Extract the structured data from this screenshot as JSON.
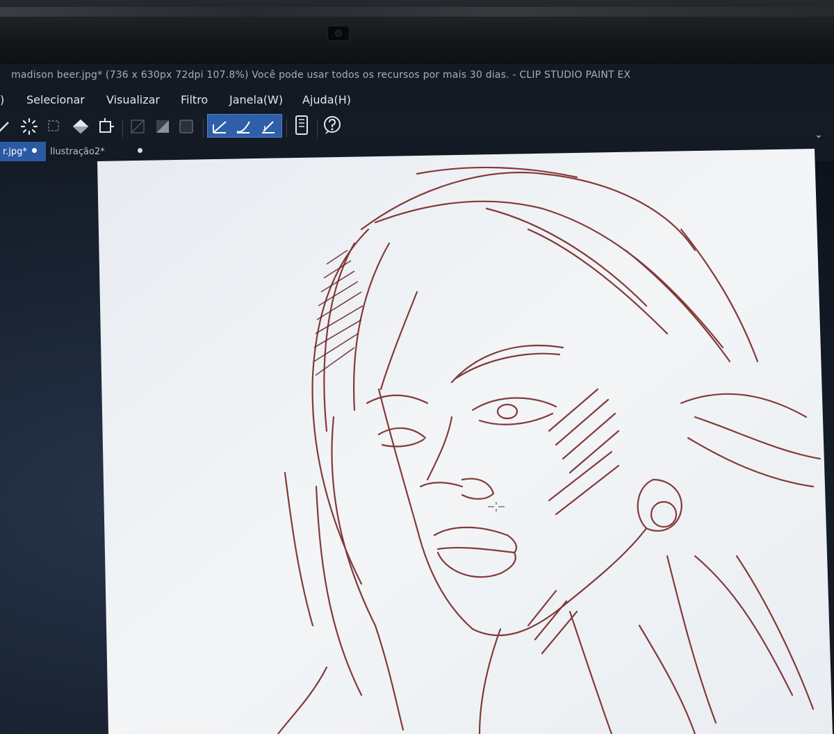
{
  "window": {
    "title": "madison beer.jpg* (736 x 630px 72dpi 107.8%)  Você pode usar todos os recursos por mais 30 dias. - CLIP STUDIO PAINT EX"
  },
  "menu": {
    "items": [
      {
        "label": ")"
      },
      {
        "label": "Selecionar"
      },
      {
        "label": "Visualizar"
      },
      {
        "label": "Filtro"
      },
      {
        "label": "Janela(W)"
      },
      {
        "label": "Ajuda(H)"
      }
    ]
  },
  "toolbar": {
    "icons": [
      "pen-icon",
      "loading-spinner-icon",
      "selection-icon",
      "fill-bucket-icon",
      "crop-icon",
      "transparent-icon",
      "gradient-icon",
      "frame-icon",
      "ruler-snap-icon",
      "brush-snap-icon",
      "line-snap-icon",
      "device-icon",
      "help-icon",
      "chevron-down-icon"
    ]
  },
  "tabs": [
    {
      "label": "r.jpg*",
      "active": true
    },
    {
      "label": "Ilustração2*",
      "active": false
    }
  ],
  "colors": {
    "accent": "#2e5fa8",
    "ink": "#7a2a2a",
    "paper": "#eef1f4"
  }
}
